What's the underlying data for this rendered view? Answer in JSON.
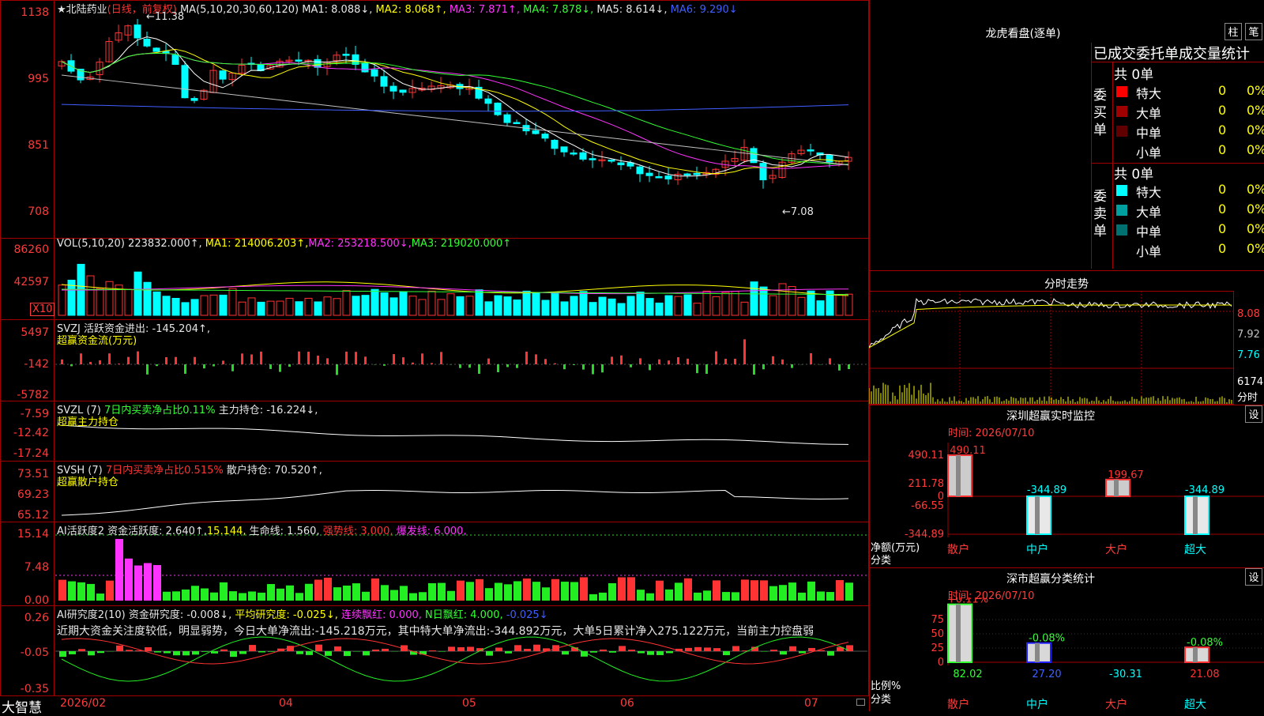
{
  "header": {
    "stock": "★北陆药业",
    "period": "(日线，前复权)",
    "ma_label": "MA(5,10,20,30,60,120)",
    "ma1": "MA1: 8.088↓,",
    "ma2": "MA2: 8.068↑,",
    "ma3": "MA3: 7.871↑,",
    "ma4": "MA4: 7.878↓,",
    "ma5": "MA5: 8.614↓,",
    "ma6": "MA6: 9.290↓"
  },
  "price_axis": [
    "1138",
    "995",
    "851",
    "708"
  ],
  "price_high": "11.38",
  "price_low": "7.08",
  "vol": {
    "label": "VOL(5,10,20)",
    "value": "223832.000↑,",
    "ma1": "MA1: 214006.203↑,",
    "ma2": "MA2: 253218.500↓,",
    "ma3": "MA3: 219020.000↑",
    "axis": [
      "86260",
      "42597"
    ],
    "unit": "X10"
  },
  "svzj": {
    "label": "SVZJ",
    "value": "活跃资金进出: -145.204↑,",
    "sub": "超赢资金流(万元)",
    "axis": [
      "5497",
      "-142",
      "-5782"
    ]
  },
  "svzl": {
    "label": "SVZL (7)",
    "ratio": "7日内买卖净占比0.11%",
    "value": "主力持仓: -16.224↓,",
    "sub": "超赢主力持仓",
    "axis": [
      "-7.59",
      "-12.42",
      "-17.24"
    ]
  },
  "svsh": {
    "label": "SVSH (7)",
    "ratio": "7日内买卖净占比0.515%",
    "value": "散户持仓: 70.520↑,",
    "sub": "超赢散户持仓",
    "axis": [
      "73.51",
      "69.23",
      "65.12"
    ]
  },
  "ai1": {
    "label": "AI活跃度2",
    "v1": "资金活跃度: 2.640↑,",
    "v2": "15.144,",
    "v3": "生命线: 1.560,",
    "v4": "强势线: 3.000,",
    "v5": "爆发线: 6.000,",
    "axis": [
      "15.14",
      "7.48",
      "0.00"
    ]
  },
  "ai2": {
    "label": "AI研究度2(10)",
    "v1": "资金研究度: -0.008↓,",
    "v2": "平均研究度: -0.025↓,",
    "v3": "连续飘红: 0.000,",
    "v4": "N日飘红: 4.000,",
    "v5": "-0.025↓",
    "text": "近期大资金关注度较低，明显弱势，今日大单净流出:-145.218万元，其中特大单净流出:-344.892万元，大单5日累计净入275.122万元，当前主力控盘弱",
    "axis": [
      "0.26",
      "-0.05",
      "-0.35"
    ]
  },
  "date_axis": [
    "2026/02",
    "04",
    "05",
    "06",
    "07"
  ],
  "app_name": "大智慧",
  "dragon": {
    "title": "龙虎看盘(逐单)",
    "btn1": "柱",
    "btn2": "笔",
    "subtitle": "已成交委托单成交量统计",
    "buy_label": "委买单",
    "sell_label": "委卖单",
    "buy_total": "共 0单",
    "sell_total": "共 0单",
    "rows_buy": [
      {
        "name": "特大",
        "count": "0",
        "pct": "0%",
        "color": "#ff0000"
      },
      {
        "name": "大单",
        "count": "0",
        "pct": "0%",
        "color": "#a00000"
      },
      {
        "name": "中单",
        "count": "0",
        "pct": "0%",
        "color": "#600000"
      },
      {
        "name": "小单",
        "count": "0",
        "pct": "0%",
        "color": ""
      }
    ],
    "rows_sell": [
      {
        "name": "特大",
        "count": "0",
        "pct": "0%",
        "color": "#00ffff"
      },
      {
        "name": "大单",
        "count": "0",
        "pct": "0%",
        "color": "#00a0a0"
      },
      {
        "name": "中单",
        "count": "0",
        "pct": "0%",
        "color": "#007070"
      },
      {
        "name": "小单",
        "count": "0",
        "pct": "0%",
        "color": ""
      }
    ]
  },
  "intraday": {
    "title": "分时走势",
    "axis": [
      "8.08",
      "7.92",
      "7.76"
    ],
    "vol_axis": "6174",
    "vol_label": "分时"
  },
  "monitor": {
    "title": "深圳超赢实时监控",
    "btn": "设",
    "time": "时间: 2026/07/10",
    "axis": [
      "490.11",
      "211.78",
      "0",
      "-66.55",
      "-344.89"
    ],
    "ylabel": "净额(万元)",
    "xlabel": "分类",
    "bars": [
      {
        "name": "散户",
        "value": "490.11"
      },
      {
        "name": "中户",
        "value": "-344.89"
      },
      {
        "name": "大户",
        "value": "199.67"
      },
      {
        "name": "超大",
        "value": "-344.89"
      }
    ]
  },
  "classify": {
    "title": "深市超赢分类统计",
    "btn": "设",
    "time": "时间: 2026/07/10",
    "axis": [
      "75",
      "50",
      "25",
      "0"
    ],
    "ylabel": "比例%",
    "xlabel": "分类",
    "bars": [
      {
        "name": "散户",
        "top": "+0.11%",
        "bottom": "82.02"
      },
      {
        "name": "中户",
        "top": "-0.08%",
        "bottom": "27.20"
      },
      {
        "name": "大户",
        "top": "",
        "bottom": "-30.31"
      },
      {
        "name": "超大",
        "top": "-0.08%",
        "bottom": "21.08"
      }
    ]
  },
  "colors": {
    "up": "#ff3333",
    "down": "#00ffff",
    "frame": "#a00000",
    "ma1": "#ffffff",
    "ma2": "#ffff00",
    "ma3": "#ff33ff",
    "ma4": "#33ff33",
    "ma5": "#c0c0c0",
    "ma6": "#3f5fff"
  }
}
